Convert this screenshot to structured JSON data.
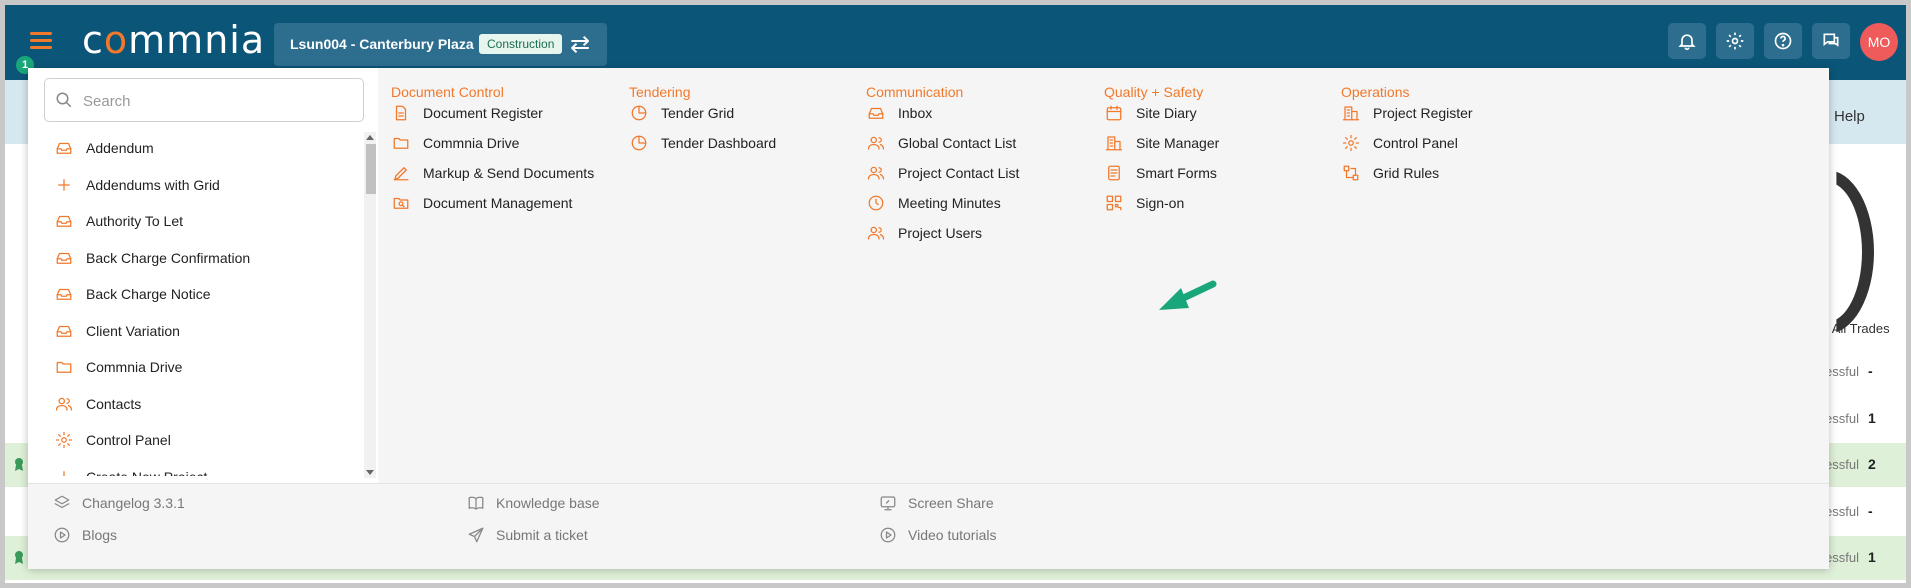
{
  "header": {
    "logo_text_1": "c",
    "logo_text_accent": "o",
    "logo_text_2": "mmnia",
    "menu_badge": "1",
    "project_name": "Lsun004 - Canterbury Plaza",
    "project_stage": "Construction",
    "avatar_initials": "MO"
  },
  "search": {
    "placeholder": "Search"
  },
  "sidebar_list": [
    {
      "label": "Addendum",
      "icon": "inbox-icon"
    },
    {
      "label": "Addendums with Grid",
      "icon": "plus-icon"
    },
    {
      "label": "Authority To Let",
      "icon": "inbox-icon"
    },
    {
      "label": "Back Charge Confirmation",
      "icon": "inbox-icon"
    },
    {
      "label": "Back Charge Notice",
      "icon": "inbox-icon"
    },
    {
      "label": "Client Variation",
      "icon": "inbox-icon"
    },
    {
      "label": "Commnia Drive",
      "icon": "folder-icon"
    },
    {
      "label": "Contacts",
      "icon": "users-icon"
    },
    {
      "label": "Control Panel",
      "icon": "gear-icon"
    },
    {
      "label": "Create New Project",
      "icon": "plus-icon"
    }
  ],
  "menu_columns": [
    {
      "title": "Document Control",
      "items": [
        {
          "label": "Document Register",
          "icon": "document-icon"
        },
        {
          "label": "Commnia Drive",
          "icon": "folder-icon"
        },
        {
          "label": "Markup & Send Documents",
          "icon": "pen-icon"
        },
        {
          "label": "Document Management",
          "icon": "folder-search-icon"
        }
      ]
    },
    {
      "title": "Tendering",
      "items": [
        {
          "label": "Tender Grid",
          "icon": "pie-chart-icon"
        },
        {
          "label": "Tender Dashboard",
          "icon": "pie-chart-icon"
        }
      ]
    },
    {
      "title": "Communication",
      "items": [
        {
          "label": "Inbox",
          "icon": "inbox-icon"
        },
        {
          "label": "Global Contact List",
          "icon": "users-icon"
        },
        {
          "label": "Project Contact List",
          "icon": "users-icon"
        },
        {
          "label": "Meeting Minutes",
          "icon": "clock-icon"
        },
        {
          "label": "Project Users",
          "icon": "users-icon"
        }
      ]
    },
    {
      "title": "Quality + Safety",
      "items": [
        {
          "label": "Site Diary",
          "icon": "calendar-icon"
        },
        {
          "label": "Site Manager",
          "icon": "building-icon"
        },
        {
          "label": "Smart Forms",
          "icon": "form-icon"
        },
        {
          "label": "Sign-on",
          "icon": "qr-code-icon"
        }
      ]
    },
    {
      "title": "Operations",
      "items": [
        {
          "label": "Project Register",
          "icon": "building-icon"
        },
        {
          "label": "Control Panel",
          "icon": "gear-icon"
        },
        {
          "label": "Grid Rules",
          "icon": "flow-icon"
        }
      ]
    }
  ],
  "footer_links": [
    {
      "label": "Changelog 3.3.1",
      "icon": "layers-icon"
    },
    {
      "label": "Blogs",
      "icon": "play-circle-icon"
    },
    {
      "label": "Knowledge base",
      "icon": "book-icon"
    },
    {
      "label": "Submit a ticket",
      "icon": "send-icon"
    },
    {
      "label": "Screen Share",
      "icon": "screen-share-icon"
    },
    {
      "label": "Video tutorials",
      "icon": "play-circle-icon"
    }
  ],
  "background_page": {
    "help_label": "Help",
    "trades_label": "l All Trades",
    "rows": [
      {
        "status": "essful",
        "count": "-"
      },
      {
        "status": "essful",
        "count": "1"
      },
      {
        "status": "essful",
        "count": "2"
      },
      {
        "status": "essful",
        "count": "-"
      },
      {
        "status": "essful",
        "count": "1"
      }
    ]
  },
  "colors": {
    "topbar": "#0b5578",
    "accent": "#f2792b",
    "badge": "#1aa67b",
    "avatar": "#ef5a5a",
    "pointer_arrow": "#1aa67b"
  }
}
